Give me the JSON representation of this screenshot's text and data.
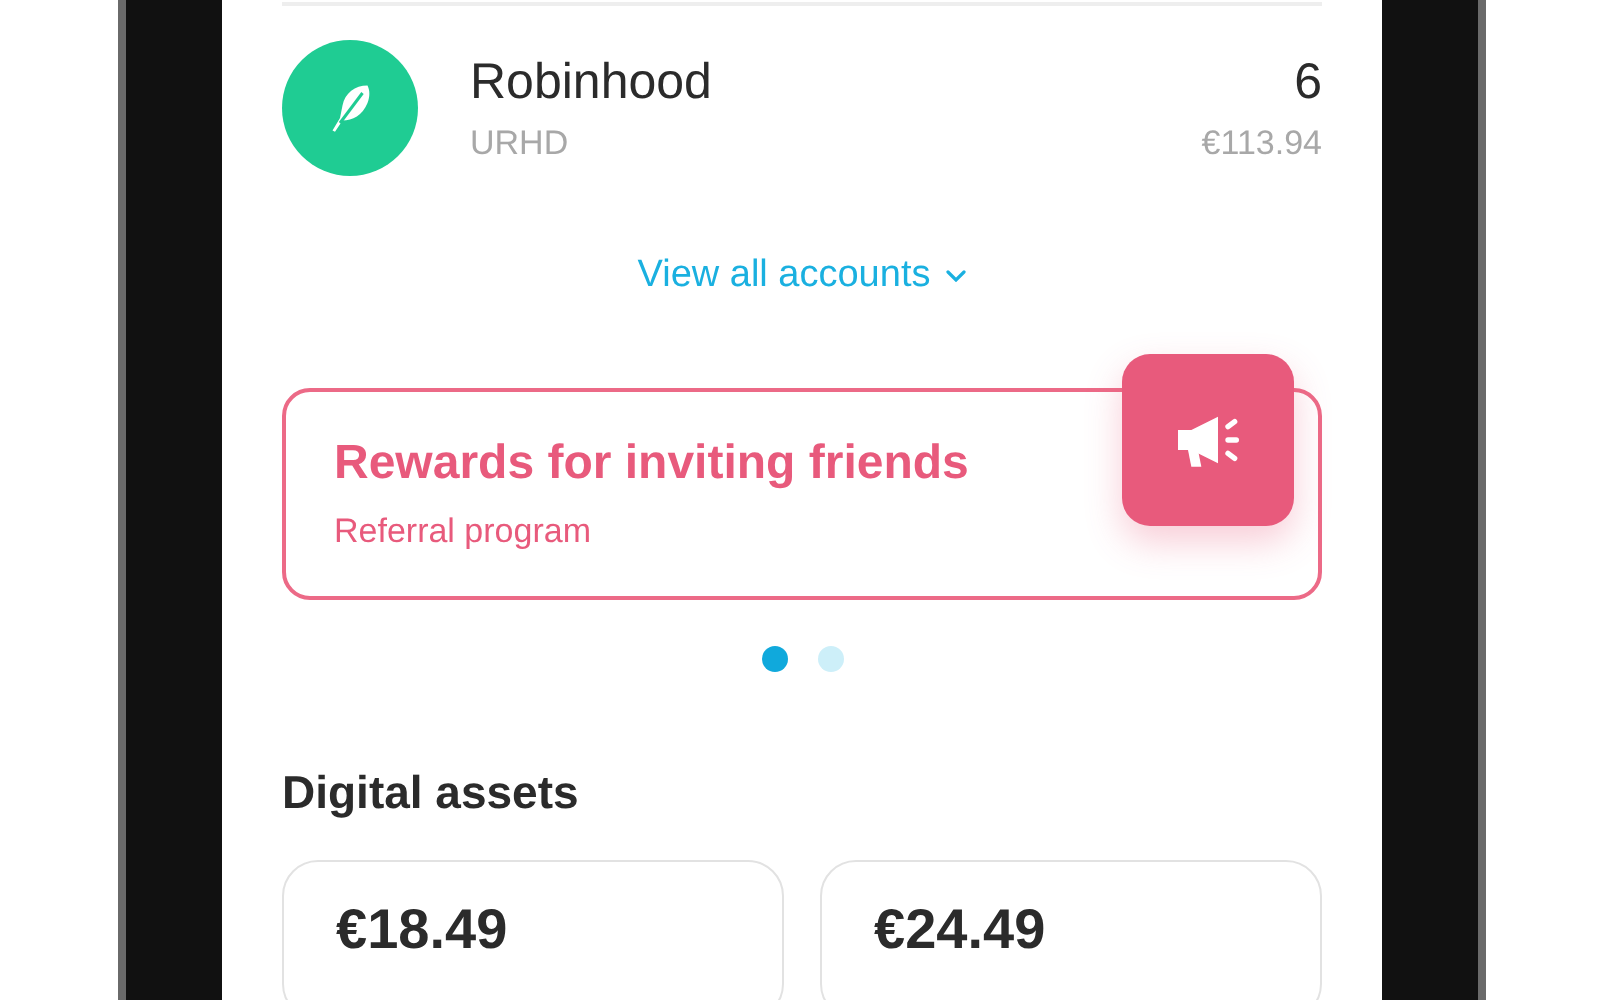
{
  "accounts": [
    {
      "name": "Robinhood",
      "ticker": "URHD",
      "quantity": "6",
      "value": "€113.94"
    }
  ],
  "view_all": {
    "label": "View all accounts"
  },
  "promo": {
    "title": "Rewards for inviting friends",
    "subtitle": "Referral program"
  },
  "carousel_dots": [
    {
      "selected": true
    },
    {
      "selected": false
    }
  ],
  "digital_assets": {
    "title": "Digital assets",
    "cards": [
      {
        "value": "€18.49"
      },
      {
        "value": "€24.49"
      }
    ]
  }
}
